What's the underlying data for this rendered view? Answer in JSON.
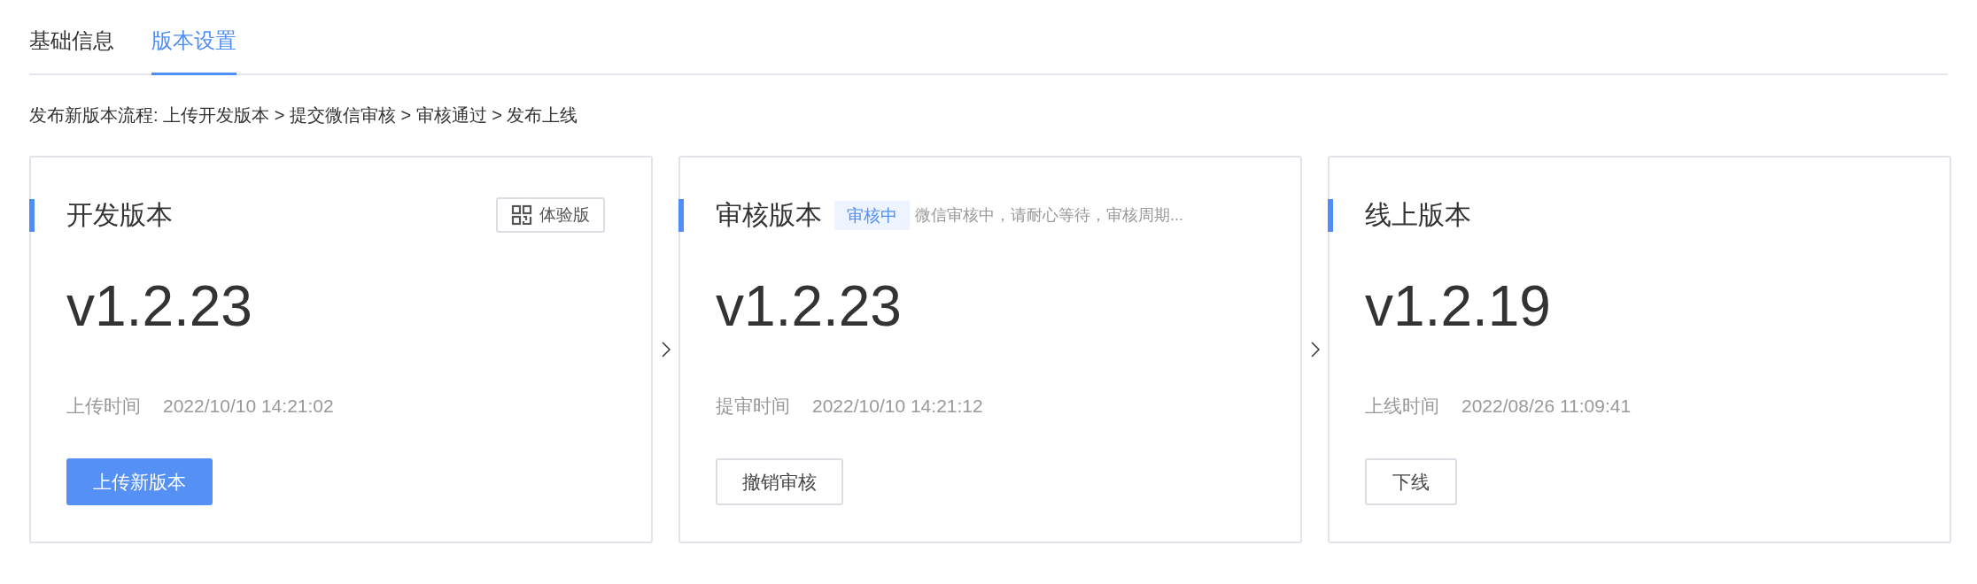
{
  "tabs": [
    {
      "label": "基础信息",
      "selected": false
    },
    {
      "label": "版本设置",
      "selected": true
    }
  ],
  "flow_text": "发布新版本流程: 上传开发版本 > 提交微信审核 > 审核通过 > 发布上线",
  "cards": [
    {
      "title": "开发版本",
      "qr_button": "体验版",
      "version": "v1.2.23",
      "time_label": "上传时间",
      "time": "2022/10/10 14:21:02",
      "action": {
        "label": "上传新版本",
        "primary": true
      }
    },
    {
      "title": "审核版本",
      "status_badge": "审核中",
      "note": "微信审核中，请耐心等待，审核周期...",
      "version": "v1.2.23",
      "time_label": "提审时间",
      "time": "2022/10/10 14:21:12",
      "action": {
        "label": "撤销审核",
        "primary": false
      }
    },
    {
      "title": "线上版本",
      "version": "v1.2.19",
      "time_label": "上线时间",
      "time": "2022/08/26 11:09:41",
      "action": {
        "label": "下线",
        "primary": false
      }
    }
  ]
}
